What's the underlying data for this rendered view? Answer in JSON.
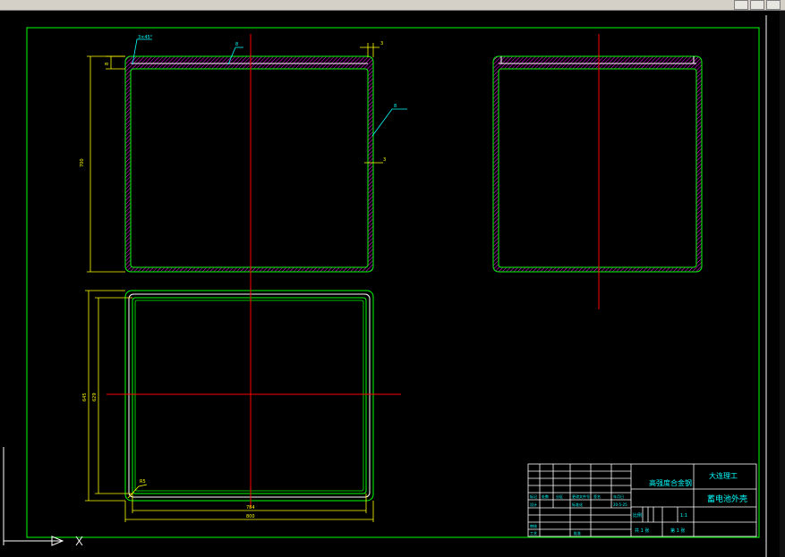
{
  "window": {
    "controls": [
      "minimize",
      "restore",
      "close"
    ]
  },
  "drawing": {
    "colors": {
      "background": "#000000",
      "frame": "#00ff00",
      "outline": "#ffffff",
      "centerline": "#ff0000",
      "dimension": "#ffff00",
      "hatch": "#ff00ff",
      "text": "#00ffff"
    },
    "front_view": {
      "label_top_left": "3×45°",
      "label_top_mid": "8",
      "label_right": "8",
      "dim_top_right": "3",
      "dim_mid_right": "3",
      "dim_height_small": "8",
      "dim_height_main": "700"
    },
    "top_view": {
      "dim_outer_height": "645",
      "dim_inner_height": "629",
      "dim_inner_width": "784",
      "dim_outer_width": "800",
      "corner_label": "R5"
    },
    "title_block": {
      "company": "大连理工",
      "material": "高强度合金钢",
      "part_name": "蓄电池外壳",
      "scale_label": "比例",
      "scale_value": "1:1",
      "sheet_info": "共 1 张",
      "sheet_num": "第 1 张",
      "cells": [
        "标记",
        "处数",
        "分区",
        "更改文件号",
        "签名",
        "年月日",
        "设计",
        "标准化",
        "审核",
        "工艺",
        "批准"
      ],
      "date": "20-5-25"
    }
  }
}
